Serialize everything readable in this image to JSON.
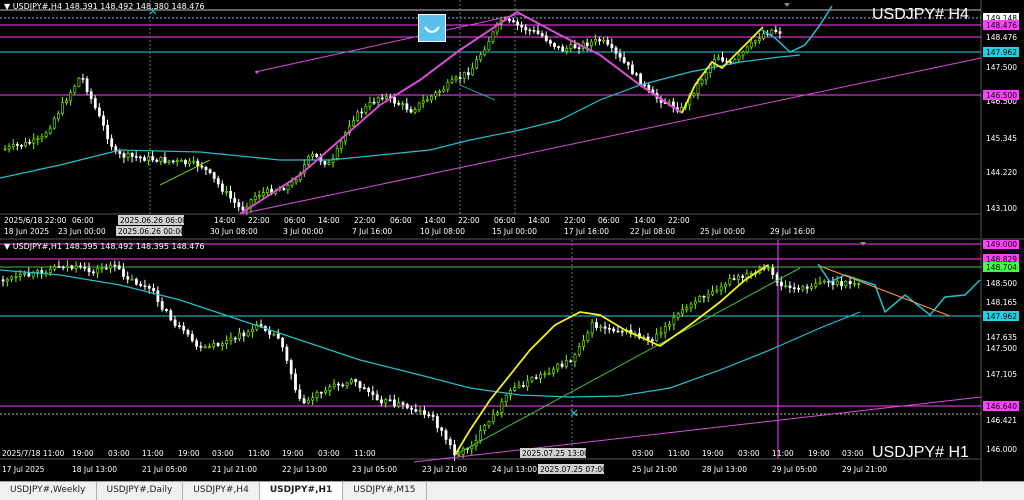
{
  "colors": {
    "bull": "#7CFC00",
    "bear": "#ffffff",
    "ma": "#20c0d0",
    "trend": "#d94cd9",
    "zigzag": "#f5f020",
    "green_line": "#40c040",
    "orange_line": "#ff9b2a",
    "axis_text": "#ffffff",
    "grid": "#4a4a4a",
    "tag_pink": "#ff40ff",
    "tag_green": "#40ff40",
    "tag_cyan": "#20d0e0",
    "tag_white": "#ffffff"
  },
  "tabs": [
    {
      "label": "USDJPY#,Weekly",
      "active": false
    },
    {
      "label": "USDJPY#,Daily",
      "active": false
    },
    {
      "label": "USDJPY#,H4",
      "active": false
    },
    {
      "label": "USDJPY#,H1",
      "active": true
    },
    {
      "label": "USDJPY#,M15",
      "active": false
    }
  ],
  "h4": {
    "header": "▼ USDJPY#,H4  148.391 148.492 148.380 148.476",
    "big_label": "USDJPY#  H4",
    "price_axis": [
      "149.148",
      "148.476",
      "147.962",
      "147.500",
      "146.500",
      "145.345",
      "144.220",
      "143.100"
    ],
    "price_tags": [
      {
        "value": "149.148",
        "kind": "white"
      },
      {
        "value": "148.476",
        "kind": "pink"
      },
      {
        "value": "147.962",
        "kind": "cyan"
      },
      {
        "value": "146.500",
        "kind": "pink"
      }
    ],
    "time_axis": [
      "2025/6/18 22:00",
      "06:00",
      "2025.06.26 06:00",
      "14:00",
      "22:00",
      "06:00",
      "14:00",
      "22:00",
      "06:00",
      "14:00",
      "22:00",
      "06:00",
      "14:00",
      "22:00",
      "06:00",
      "14:00",
      "22:00"
    ],
    "date_axis": [
      "18 Jun 2025",
      "23 Jun 00:00",
      "2025.06.26 00:00",
      "30 Jun 08:00",
      "3 Jul 00:00",
      "7 Jul 16:00",
      "10 Jul 08:00",
      "15 Jul 00:00",
      "17 Jul 16:00",
      "22 Jul 08:00",
      "25 Jul 00:00",
      "29 Jul 16:00"
    ]
  },
  "h1": {
    "header": "▼ USDJPY#,H1  148.395 148.492 148.395 148.476",
    "big_label": "USDJPY#  H1",
    "price_axis": [
      "149.000",
      "148.829",
      "148.704",
      "148.500",
      "148.165",
      "147.962",
      "147.635",
      "147.500",
      "147.105",
      "146.640",
      "146.421",
      "146.000"
    ],
    "price_tags": [
      {
        "value": "149.000",
        "kind": "pink"
      },
      {
        "value": "148.829",
        "kind": "pink"
      },
      {
        "value": "148.704",
        "kind": "green"
      },
      {
        "value": "147.962",
        "kind": "cyan"
      },
      {
        "value": "146.640",
        "kind": "pink"
      }
    ],
    "time_axis": [
      "2025/7/18 11:00",
      "19:00",
      "03:00",
      "11:00",
      "19:00",
      "03:00",
      "11:00",
      "19:00",
      "03:00",
      "11:00",
      "2025.07.25 13:00",
      "03:00",
      "11:00",
      "19:00",
      "03:00",
      "11:00",
      "19:00",
      "03:00"
    ],
    "date_axis": [
      "17 Jul 2025",
      "18 Jul 13:00",
      "21 Jul 05:00",
      "21 Jul 21:00",
      "22 Jul 13:00",
      "23 Jul 05:00",
      "23 Jul 21:00",
      "24 Jul 13:00",
      "2025.07.25 07:00",
      "25 Jul 21:00",
      "28 Jul 13:00",
      "29 Jul 05:00",
      "29 Jul 21:00"
    ]
  }
}
